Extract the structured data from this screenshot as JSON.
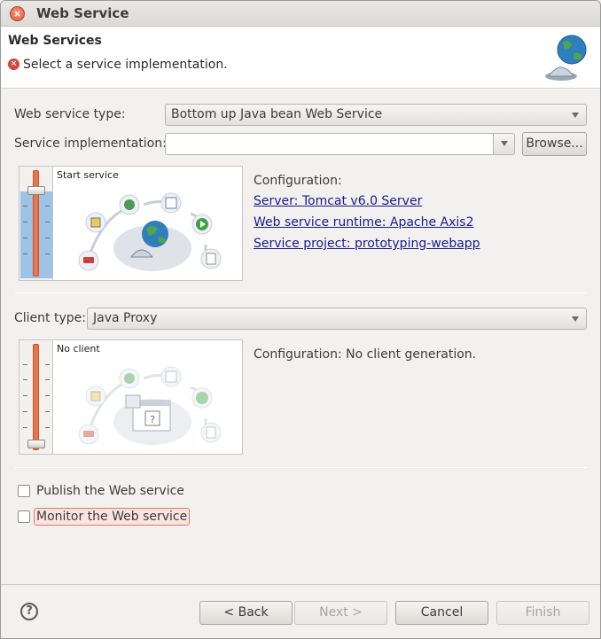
{
  "window": {
    "title": "Web Service"
  },
  "banner": {
    "title": "Web Services",
    "message": "Select a service implementation."
  },
  "service": {
    "type_label": "Web service type:",
    "type_value": "Bottom up Java bean Web Service",
    "impl_label": "Service implementation:",
    "impl_value": "",
    "browse_label": "Browse...",
    "panel_caption": "Start service",
    "config_label": "Configuration:",
    "server_link": "Server: Tomcat v6.0 Server",
    "runtime_link": "Web service runtime: Apache Axis2",
    "project_link": "Service project: prototyping-webapp"
  },
  "client": {
    "type_label": "Client type:",
    "type_value": "Java Proxy",
    "panel_caption": "No client",
    "config_text": "Configuration: No client generation."
  },
  "options": {
    "publish_label": "Publish the Web service",
    "publish_checked": false,
    "monitor_label": "Monitor the Web service",
    "monitor_checked": false
  },
  "footer": {
    "back_label": "< Back",
    "next_label": "Next >",
    "cancel_label": "Cancel",
    "finish_label": "Finish"
  },
  "icons": {
    "close": "close-icon",
    "error": "error-icon",
    "banner": "globe-service-icon",
    "help": "help-icon"
  }
}
